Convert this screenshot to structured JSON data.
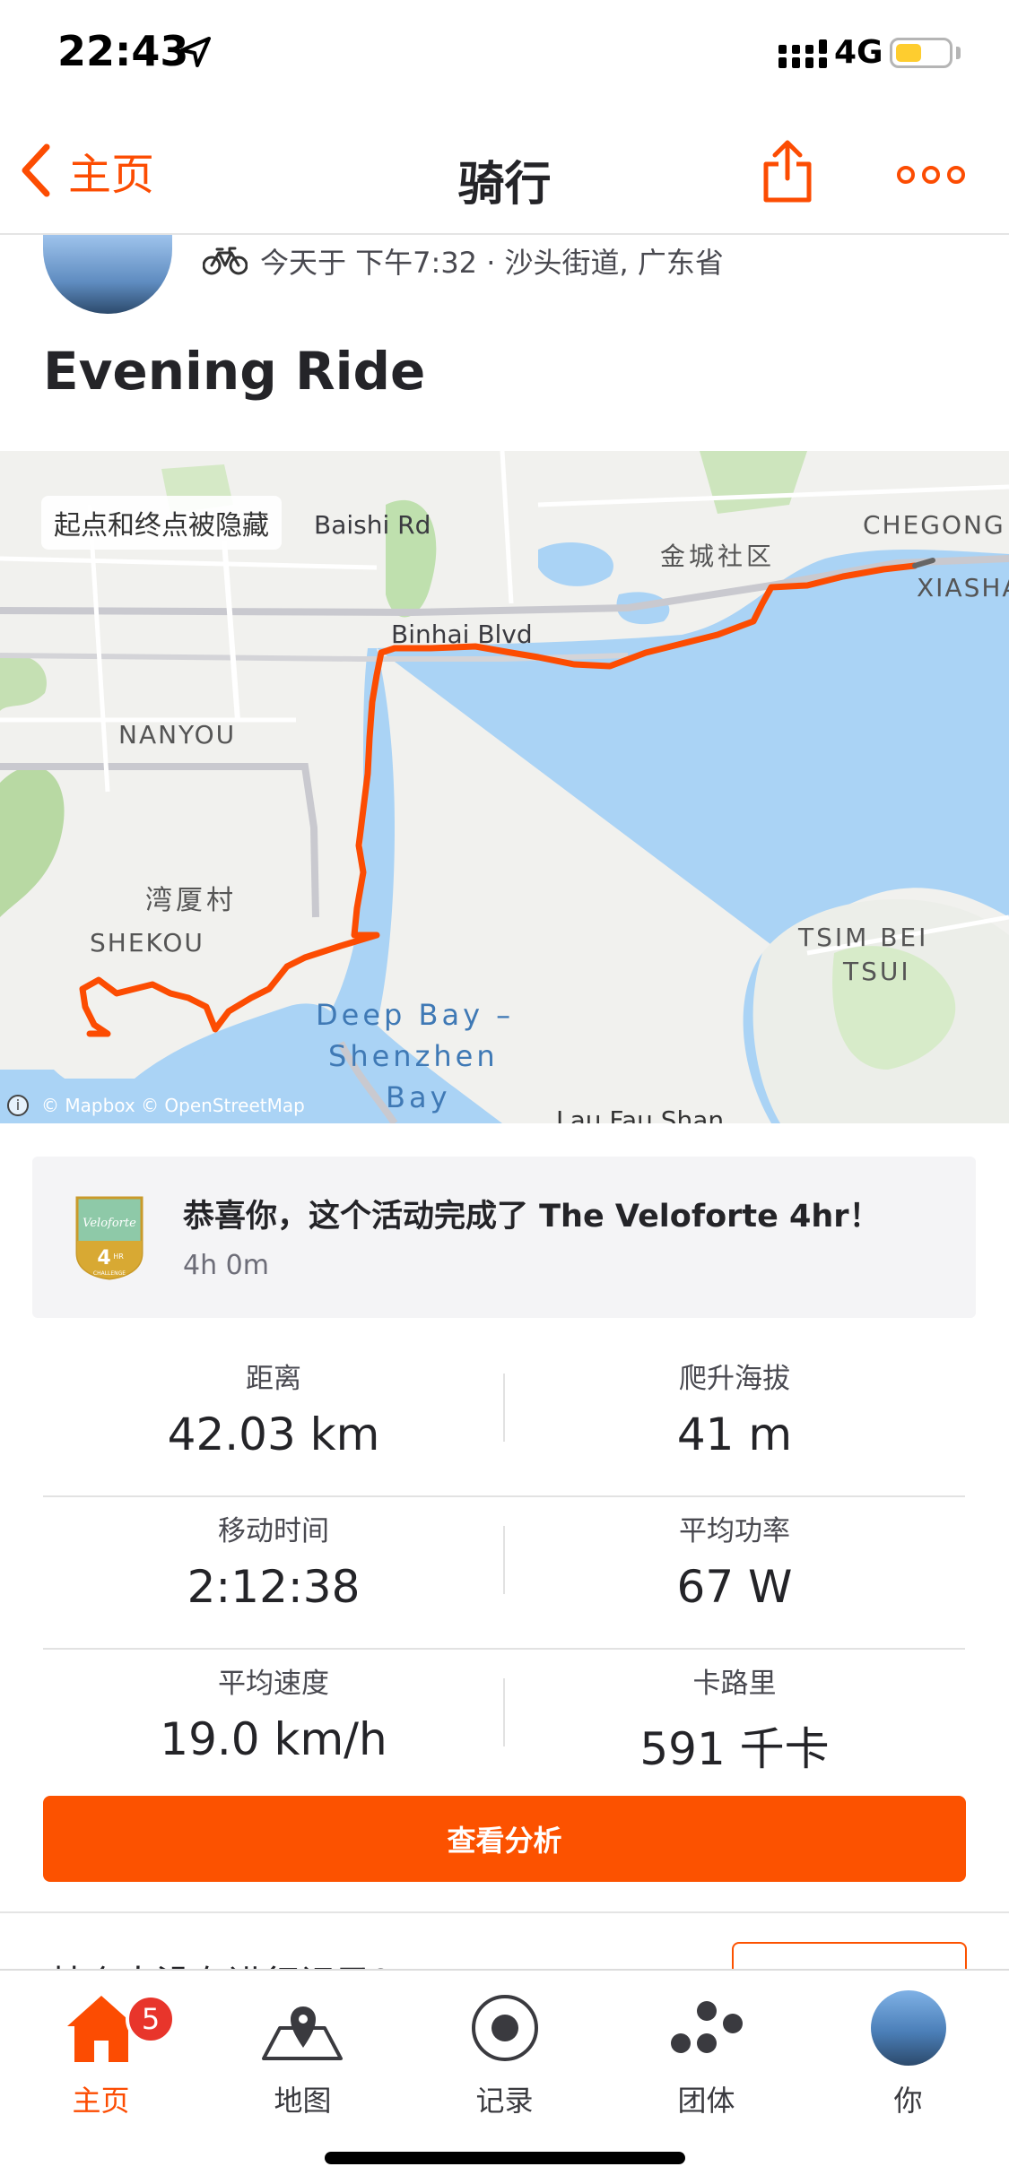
{
  "status_bar": {
    "time": "22:43",
    "network": "4G",
    "icons": [
      "location-arrow-icon",
      "signal-bars-icon",
      "battery-icon"
    ],
    "battery_color": "#fecd2f"
  },
  "nav": {
    "back_label": "主页",
    "title": "骑行",
    "share_icon": "share-icon",
    "more_icon": "more-dots-icon"
  },
  "activity": {
    "meta": "今天于 下午7:32 · 沙头街道, 广东省",
    "sport_icon": "bicycle-icon",
    "title": "Evening Ride"
  },
  "map": {
    "privacy_note": "起点和终点被隐藏",
    "labels": {
      "baishi": "Baishi Rd",
      "binhai": "Binhai Blvd",
      "jincheng": "金城社区",
      "chegong": "CHEGONG",
      "xiasha": "XIASHA",
      "nanyou": "NANYOU",
      "wanxia": "湾厦村",
      "shekou": "SHEKOU",
      "tsim_bei_tsui_1": "TSIM BEI",
      "tsim_bei_tsui_2": "TSUI",
      "bay_1": "Deep Bay –",
      "bay_2": "Shenzhen",
      "bay_3": "Bay",
      "lau_fau_shan": "Lau Fau Shan"
    },
    "attribution": "© Mapbox © OpenStreetMap",
    "route_color": "#fc4c02",
    "water_color": "#aad3f5"
  },
  "achievement": {
    "title": "恭喜你，这个活动完成了 The Veloforte 4hr！",
    "subtitle": "4h 0m",
    "badge": {
      "brand": "Veloforte",
      "number": "4",
      "unit": "HR",
      "caption": "CHALLENGE"
    }
  },
  "stats": [
    {
      "left": {
        "label": "距离",
        "value": "42.03 km"
      },
      "right": {
        "label": "爬升海拔",
        "value": "41 m"
      }
    },
    {
      "left": {
        "label": "移动时间",
        "value": "2:12:38"
      },
      "right": {
        "label": "平均功率",
        "value": "67 W"
      }
    },
    {
      "left": {
        "label": "平均速度",
        "value": "19.0 km/h"
      },
      "right": {
        "label": "卡路里",
        "value": "591 千卡"
      }
    }
  ],
  "analysis_button": "查看分析",
  "peek_text": "某个人没有进行记录？",
  "tabs": [
    {
      "label": "主页",
      "icon": "home-icon",
      "badge": "5",
      "active": true
    },
    {
      "label": "地图",
      "icon": "map-icon",
      "active": false
    },
    {
      "label": "记录",
      "icon": "record-icon",
      "active": false
    },
    {
      "label": "团体",
      "icon": "groups-icon",
      "active": false
    },
    {
      "label": "你",
      "icon": "avatar",
      "active": false
    }
  ],
  "brand_color": "#fc4c02"
}
